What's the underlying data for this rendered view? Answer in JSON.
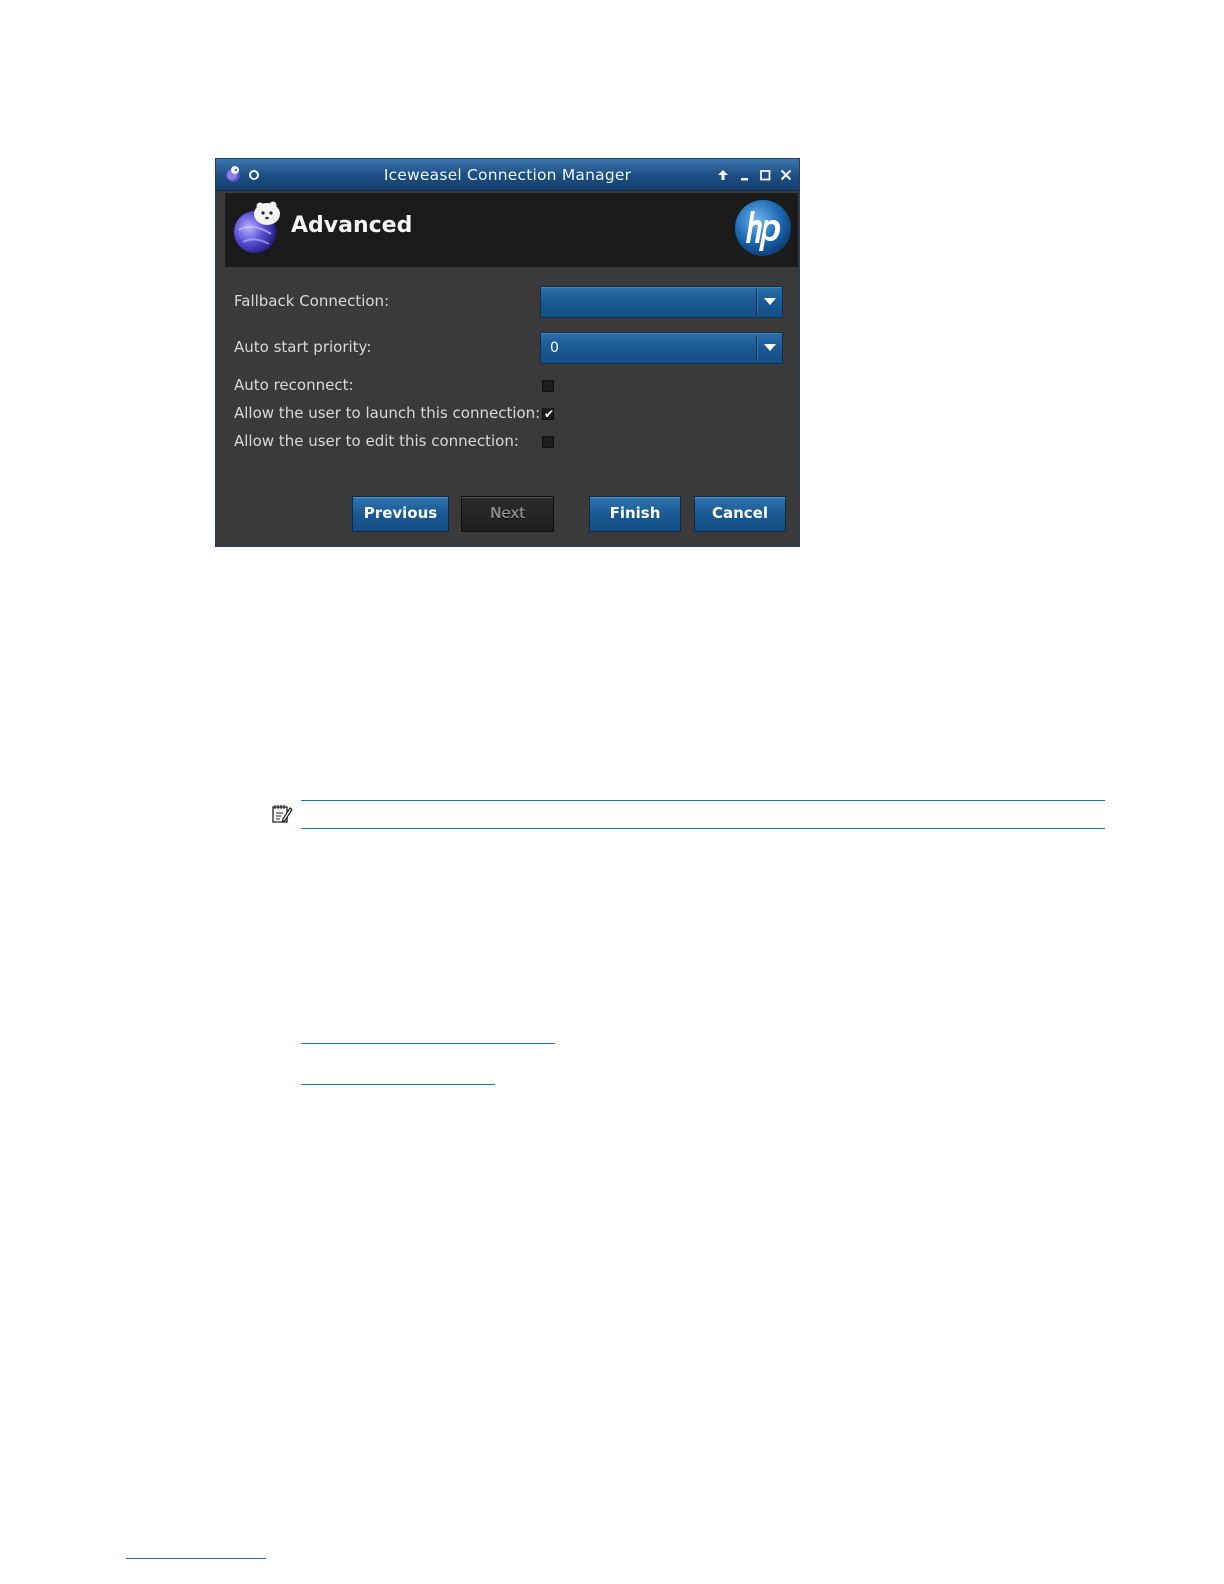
{
  "window": {
    "title": "Iceweasel Connection Manager",
    "app_icon": "iceweasel-icon",
    "titlebar_buttons": [
      "pin-icon",
      "up-arrow-icon",
      "minimize-icon",
      "maximize-icon",
      "close-icon"
    ]
  },
  "banner": {
    "title": "Advanced",
    "app_icon": "iceweasel-icon",
    "logo": "hp"
  },
  "form": {
    "fallback_connection": {
      "label": "Fallback Connection:",
      "value": ""
    },
    "auto_start_priority": {
      "label": "Auto start priority:",
      "value": "0"
    },
    "auto_reconnect": {
      "label": "Auto reconnect:",
      "checked": false
    },
    "allow_launch": {
      "label": "Allow the user to launch this connection:",
      "checked": true,
      "mark": "✔"
    },
    "allow_edit": {
      "label": "Allow the user to edit this connection:",
      "checked": false
    }
  },
  "buttons": {
    "previous": "Previous",
    "next": "Next",
    "finish": "Finish",
    "cancel": "Cancel"
  },
  "colors": {
    "titlebar": "#1c4d82",
    "accent_blue": "#1a5a95",
    "window_bg": "#3a3a3a",
    "banner_bg": "#1b1b1b",
    "link_rule": "#1f6fb5"
  },
  "document": {
    "note_icon": "note-icon"
  }
}
